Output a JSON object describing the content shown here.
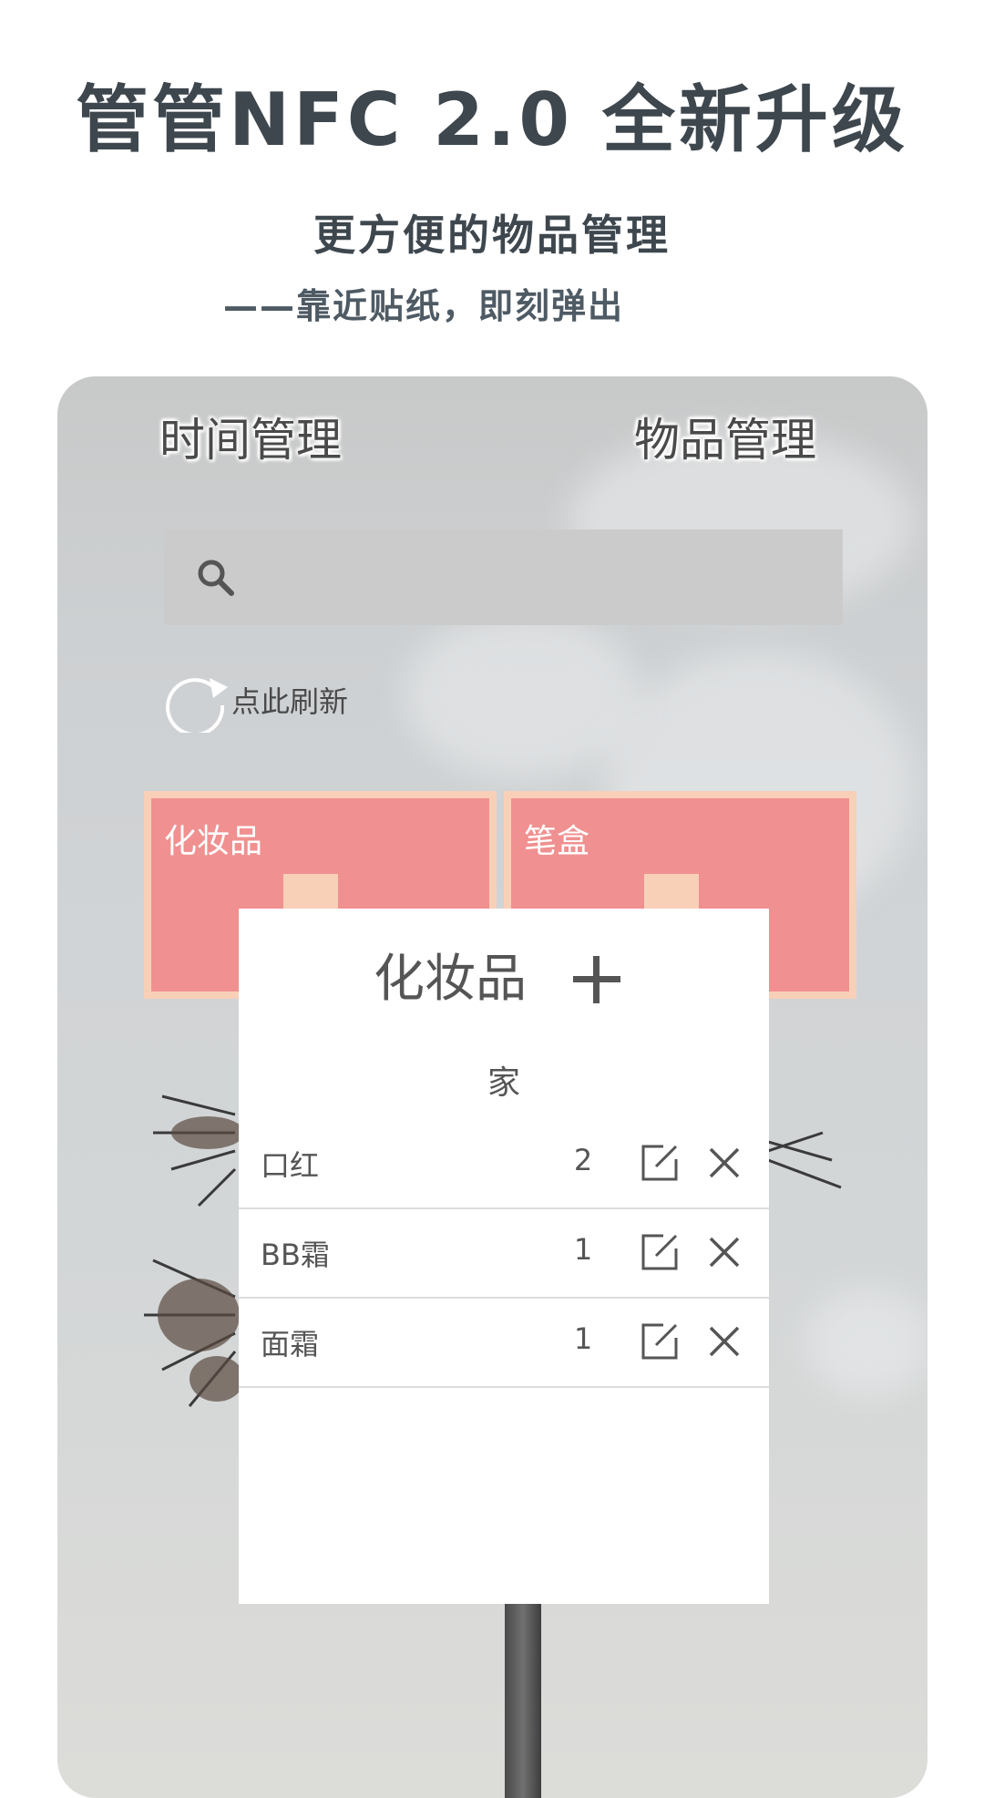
{
  "promo": {
    "title": "管管NFC 2.0 全新升级",
    "subtitle": "更方便的物品管理",
    "tagline": "——靠近贴纸，即刻弹出"
  },
  "app": {
    "tabs": {
      "time": "时间管理",
      "items": "物品管理"
    },
    "search": {
      "icon": "search-icon",
      "value": ""
    },
    "refresh": {
      "icon": "refresh-icon",
      "label": "点此刷新"
    },
    "categories": [
      {
        "name": "化妆品"
      },
      {
        "name": "笔盒"
      }
    ],
    "colors": {
      "category_bg": "#f09090",
      "category_border": "#f8d0b8",
      "search_bg": "#cbcbcb"
    }
  },
  "popup": {
    "title": "化妆品",
    "add_icon": "plus-icon",
    "location": "家",
    "items": [
      {
        "name": "口红",
        "qty": "2"
      },
      {
        "name": "BB霜",
        "qty": "1"
      },
      {
        "name": "面霜",
        "qty": "1"
      }
    ],
    "edit_icon": "edit-icon",
    "delete_icon": "close-icon"
  }
}
